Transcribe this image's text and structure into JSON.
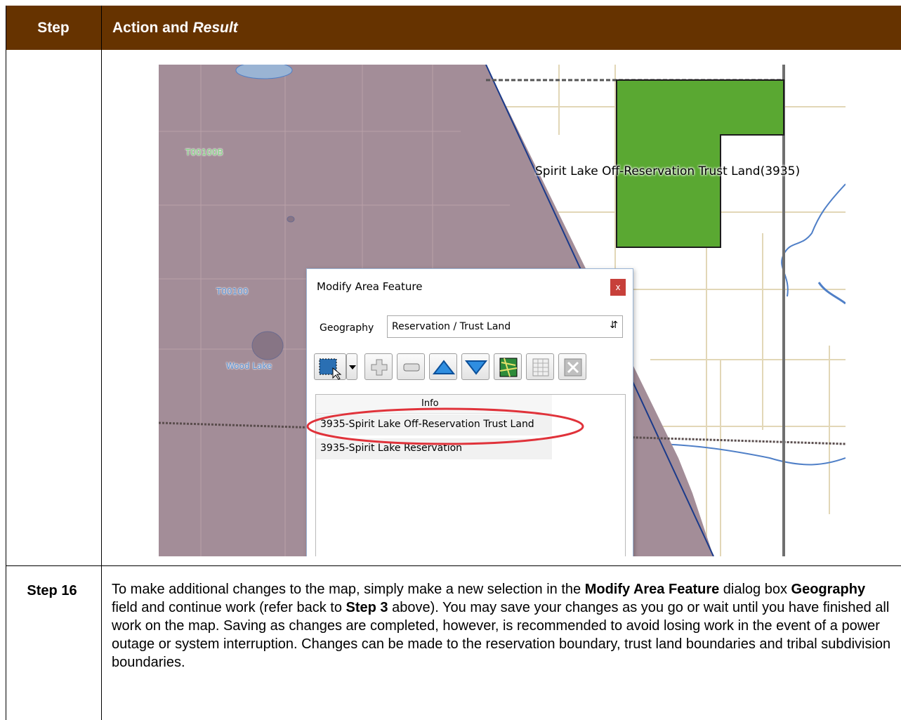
{
  "table": {
    "header_step": "Step",
    "header_action": "Action and",
    "header_result": "Result",
    "header_color": "#663300"
  },
  "map": {
    "label_t00100b": "T00100B",
    "label_t00100": "T00100",
    "label_wood_lake": "Wood Lake",
    "label_trust_land": "Spirit Lake Off-Reservation Trust Land(3935)",
    "reservation_fill": "#a38d98",
    "trust_land_fill": "#5aa832"
  },
  "dialog": {
    "title": "Modify Area Feature",
    "close_label": "x",
    "geography_label": "Geography",
    "geography_value": "Reservation / Trust Land",
    "list_header": "Info",
    "rows": [
      "3935-Spirit Lake Off-Reservation Trust Land",
      "3935-Spirit Lake Reservation"
    ],
    "toolbar_icons": [
      "select-area-icon",
      "dropdown-arrow-icon",
      "add-icon",
      "remove-icon",
      "move-up-icon",
      "move-down-icon",
      "map-icon",
      "table-icon",
      "clear-icon"
    ]
  },
  "step16": {
    "label": "Step 16",
    "text_parts": [
      "To make additional changes to the map, simply make a new selection in the ",
      "Modify Area Feature",
      " dialog box ",
      "Geography",
      " field and continue work (refer back to ",
      "Step 3",
      " above). You may save your changes as you go or wait until you have finished all work on the map. Saving as changes are completed, however, is recommended to avoid losing work in the event of a power outage or system interruption. Changes can be made to the reservation boundary, trust land boundaries and tribal subdivision boundaries."
    ]
  }
}
